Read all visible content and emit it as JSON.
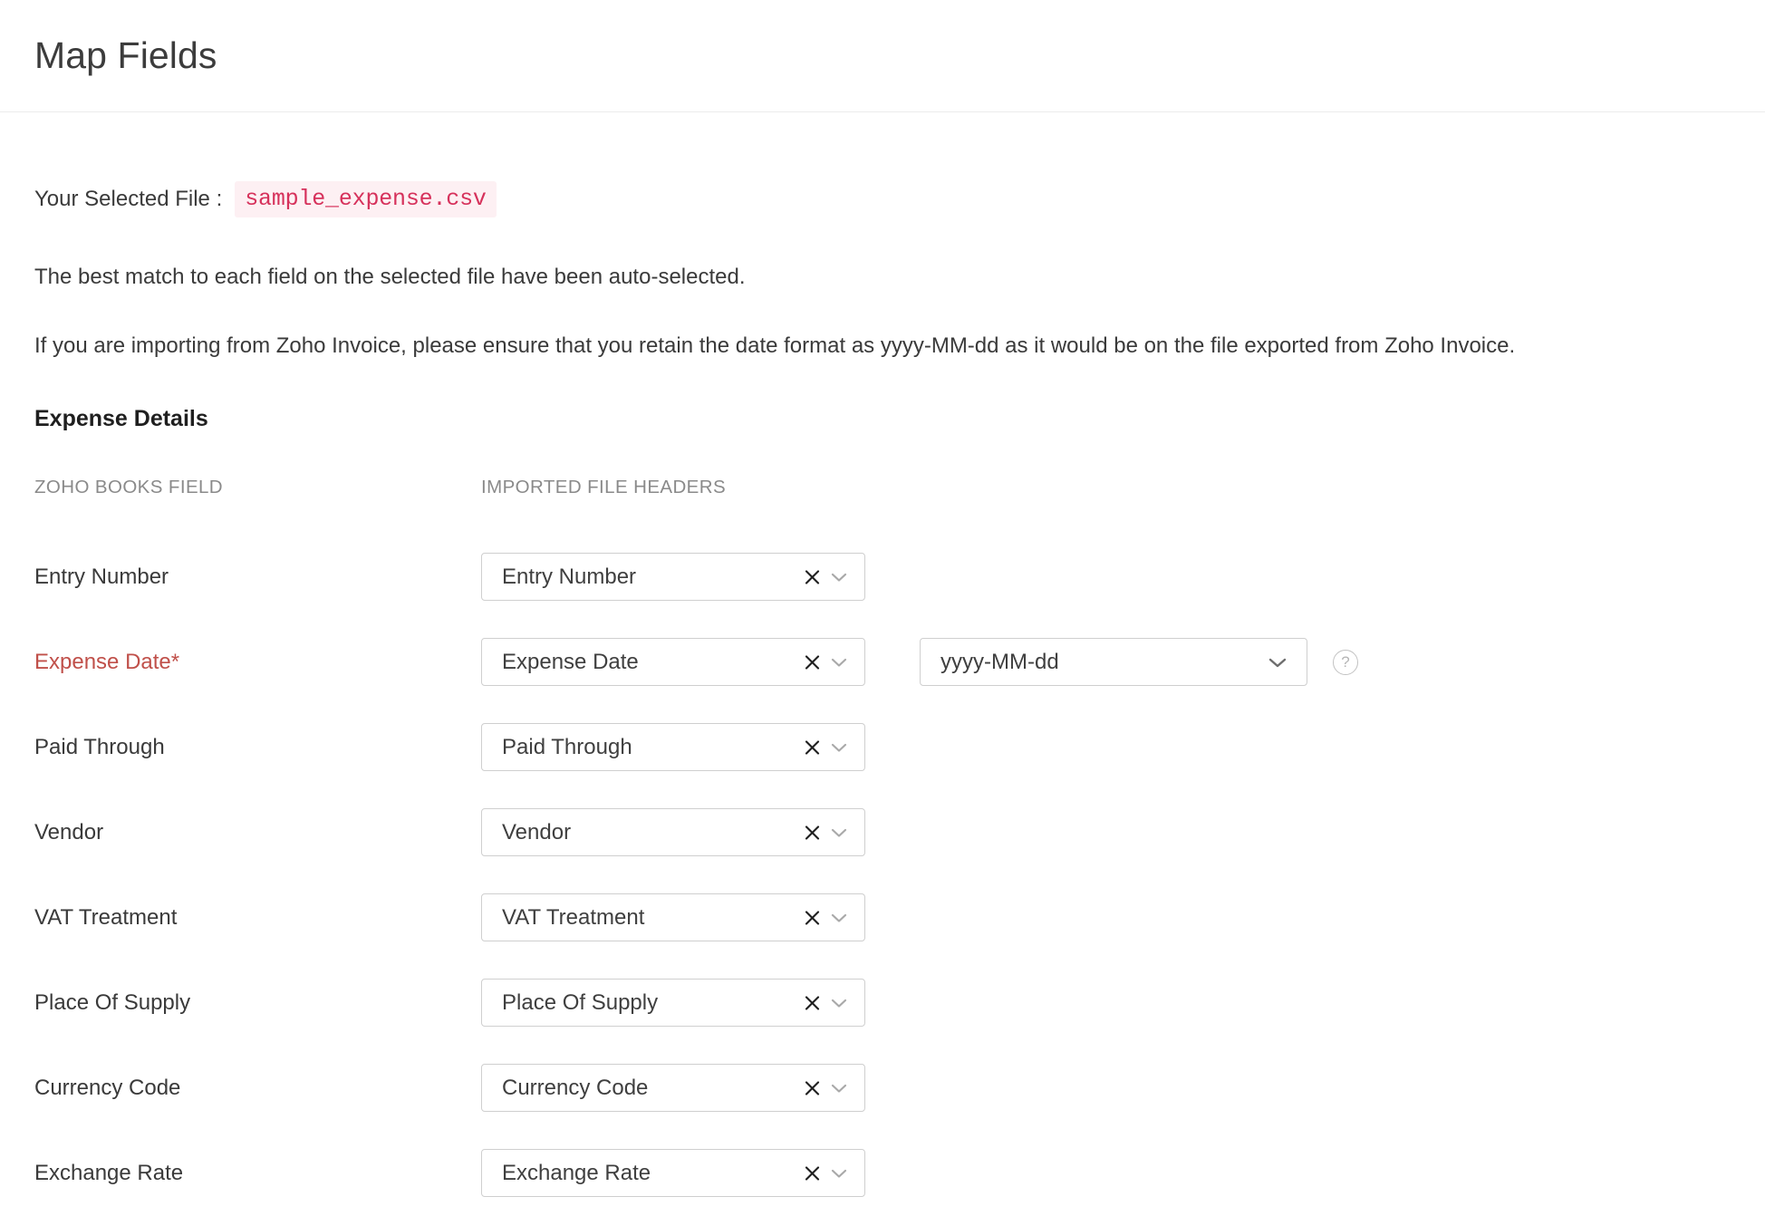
{
  "header": {
    "title": "Map Fields"
  },
  "file_info": {
    "label": "Your Selected File :",
    "file_name": "sample_expense.csv"
  },
  "instructions": {
    "line1": "The best match to each field on the selected file have been auto-selected.",
    "line2": "If you are importing from Zoho Invoice, please ensure that you retain the date format as yyyy-MM-dd as it would be on the file exported from Zoho Invoice."
  },
  "section": {
    "title": "Expense Details",
    "col_header_field": "ZOHO BOOKS FIELD",
    "col_header_imported": "IMPORTED FILE HEADERS"
  },
  "colors": {
    "required_red": "#c0504a",
    "file_pill_text": "#d6315b",
    "file_pill_bg": "#fdf0f3",
    "border": "#cfcfcf",
    "muted_text": "#8a8a8a"
  },
  "icons": {
    "clear": "close-icon",
    "caret": "chevron-down-icon",
    "help": "help-circle-icon",
    "help_glyph": "?"
  },
  "rows": [
    {
      "field": "Entry Number",
      "required": false,
      "mapped": "Entry Number",
      "has_date_format": false
    },
    {
      "field": "Expense Date*",
      "required": true,
      "mapped": "Expense Date",
      "has_date_format": true,
      "date_format": "yyyy-MM-dd"
    },
    {
      "field": "Paid Through",
      "required": false,
      "mapped": "Paid Through",
      "has_date_format": false
    },
    {
      "field": "Vendor",
      "required": false,
      "mapped": "Vendor",
      "has_date_format": false
    },
    {
      "field": "VAT Treatment",
      "required": false,
      "mapped": "VAT Treatment",
      "has_date_format": false
    },
    {
      "field": "Place Of Supply",
      "required": false,
      "mapped": "Place Of Supply",
      "has_date_format": false
    },
    {
      "field": "Currency Code",
      "required": false,
      "mapped": "Currency Code",
      "has_date_format": false
    },
    {
      "field": "Exchange Rate",
      "required": false,
      "mapped": "Exchange Rate",
      "has_date_format": false
    }
  ]
}
